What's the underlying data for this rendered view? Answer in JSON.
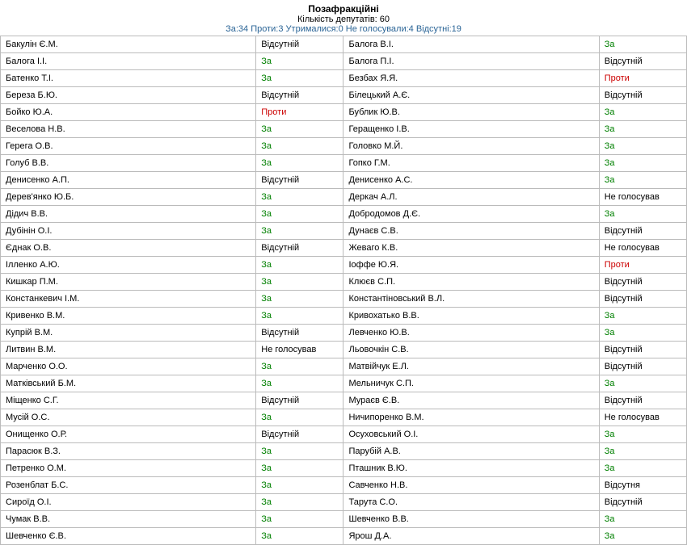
{
  "header": {
    "title": "Позафракційні",
    "subtitle": "Кількість депутатів: 60",
    "summary": {
      "for": "За:34",
      "against": "Проти:3",
      "abstain": "Утрималися:0",
      "novote": "Не голосували:4",
      "absent": "Відсутні:19"
    }
  },
  "voteClasses": {
    "За": "v-for",
    "Проти": "v-against",
    "Відсутній": "v-absent",
    "Відсутня": "v-absent",
    "Не голосував": "v-novote"
  },
  "rows": [
    {
      "l_name": "Бакулін Є.М.",
      "l_vote": "Відсутній",
      "r_name": "Балога В.І.",
      "r_vote": "За"
    },
    {
      "l_name": "Балога І.І.",
      "l_vote": "За",
      "r_name": "Балога П.І.",
      "r_vote": "Відсутній"
    },
    {
      "l_name": "Батенко Т.І.",
      "l_vote": "За",
      "r_name": "Безбах Я.Я.",
      "r_vote": "Проти"
    },
    {
      "l_name": "Береза Б.Ю.",
      "l_vote": "Відсутній",
      "r_name": "Білецький А.Є.",
      "r_vote": "Відсутній"
    },
    {
      "l_name": "Бойко Ю.А.",
      "l_vote": "Проти",
      "r_name": "Бублик Ю.В.",
      "r_vote": "За"
    },
    {
      "l_name": "Веселова Н.В.",
      "l_vote": "За",
      "r_name": "Геращенко І.В.",
      "r_vote": "За"
    },
    {
      "l_name": "Герега О.В.",
      "l_vote": "За",
      "r_name": "Головко М.Й.",
      "r_vote": "За"
    },
    {
      "l_name": "Голуб В.В.",
      "l_vote": "За",
      "r_name": "Гопко Г.М.",
      "r_vote": "За"
    },
    {
      "l_name": "Денисенко А.П.",
      "l_vote": "Відсутній",
      "r_name": "Денисенко А.С.",
      "r_vote": "За"
    },
    {
      "l_name": "Дерев'янко Ю.Б.",
      "l_vote": "За",
      "r_name": "Деркач А.Л.",
      "r_vote": "Не голосував"
    },
    {
      "l_name": "Дідич В.В.",
      "l_vote": "За",
      "r_name": "Добродомов Д.Є.",
      "r_vote": "За"
    },
    {
      "l_name": "Дубінін О.І.",
      "l_vote": "За",
      "r_name": "Дунаєв С.В.",
      "r_vote": "Відсутній"
    },
    {
      "l_name": "Єднак О.В.",
      "l_vote": "Відсутній",
      "r_name": "Жеваго К.В.",
      "r_vote": "Не голосував"
    },
    {
      "l_name": "Ілленко А.Ю.",
      "l_vote": "За",
      "r_name": "Іоффе Ю.Я.",
      "r_vote": "Проти"
    },
    {
      "l_name": "Кишкар П.М.",
      "l_vote": "За",
      "r_name": "Клюєв С.П.",
      "r_vote": "Відсутній"
    },
    {
      "l_name": "Констанкевич І.М.",
      "l_vote": "За",
      "r_name": "Константіновський В.Л.",
      "r_vote": "Відсутній"
    },
    {
      "l_name": "Кривенко В.М.",
      "l_vote": "За",
      "r_name": "Кривохатько В.В.",
      "r_vote": "За"
    },
    {
      "l_name": "Купрій В.М.",
      "l_vote": "Відсутній",
      "r_name": "Левченко Ю.В.",
      "r_vote": "За"
    },
    {
      "l_name": "Литвин В.М.",
      "l_vote": "Не голосував",
      "r_name": "Льовочкін С.В.",
      "r_vote": "Відсутній"
    },
    {
      "l_name": "Марченко О.О.",
      "l_vote": "За",
      "r_name": "Матвійчук Е.Л.",
      "r_vote": "Відсутній"
    },
    {
      "l_name": "Матківський Б.М.",
      "l_vote": "За",
      "r_name": "Мельничук С.П.",
      "r_vote": "За"
    },
    {
      "l_name": "Міщенко С.Г.",
      "l_vote": "Відсутній",
      "r_name": "Мураєв Є.В.",
      "r_vote": "Відсутній"
    },
    {
      "l_name": "Мусій О.С.",
      "l_vote": "За",
      "r_name": "Ничипоренко В.М.",
      "r_vote": "Не голосував"
    },
    {
      "l_name": "Онищенко О.Р.",
      "l_vote": "Відсутній",
      "r_name": "Осуховський О.І.",
      "r_vote": "За"
    },
    {
      "l_name": "Парасюк В.З.",
      "l_vote": "За",
      "r_name": "Парубій А.В.",
      "r_vote": "За"
    },
    {
      "l_name": "Петренко О.М.",
      "l_vote": "За",
      "r_name": "Пташник В.Ю.",
      "r_vote": "За"
    },
    {
      "l_name": "Розенблат Б.С.",
      "l_vote": "За",
      "r_name": "Савченко Н.В.",
      "r_vote": "Відсутня"
    },
    {
      "l_name": "Сироїд О.І.",
      "l_vote": "За",
      "r_name": "Тарута С.О.",
      "r_vote": "Відсутній"
    },
    {
      "l_name": "Чумак В.В.",
      "l_vote": "За",
      "r_name": "Шевченко В.В.",
      "r_vote": "За"
    },
    {
      "l_name": "Шевченко Є.В.",
      "l_vote": "За",
      "r_name": "Ярош Д.А.",
      "r_vote": "За"
    }
  ]
}
